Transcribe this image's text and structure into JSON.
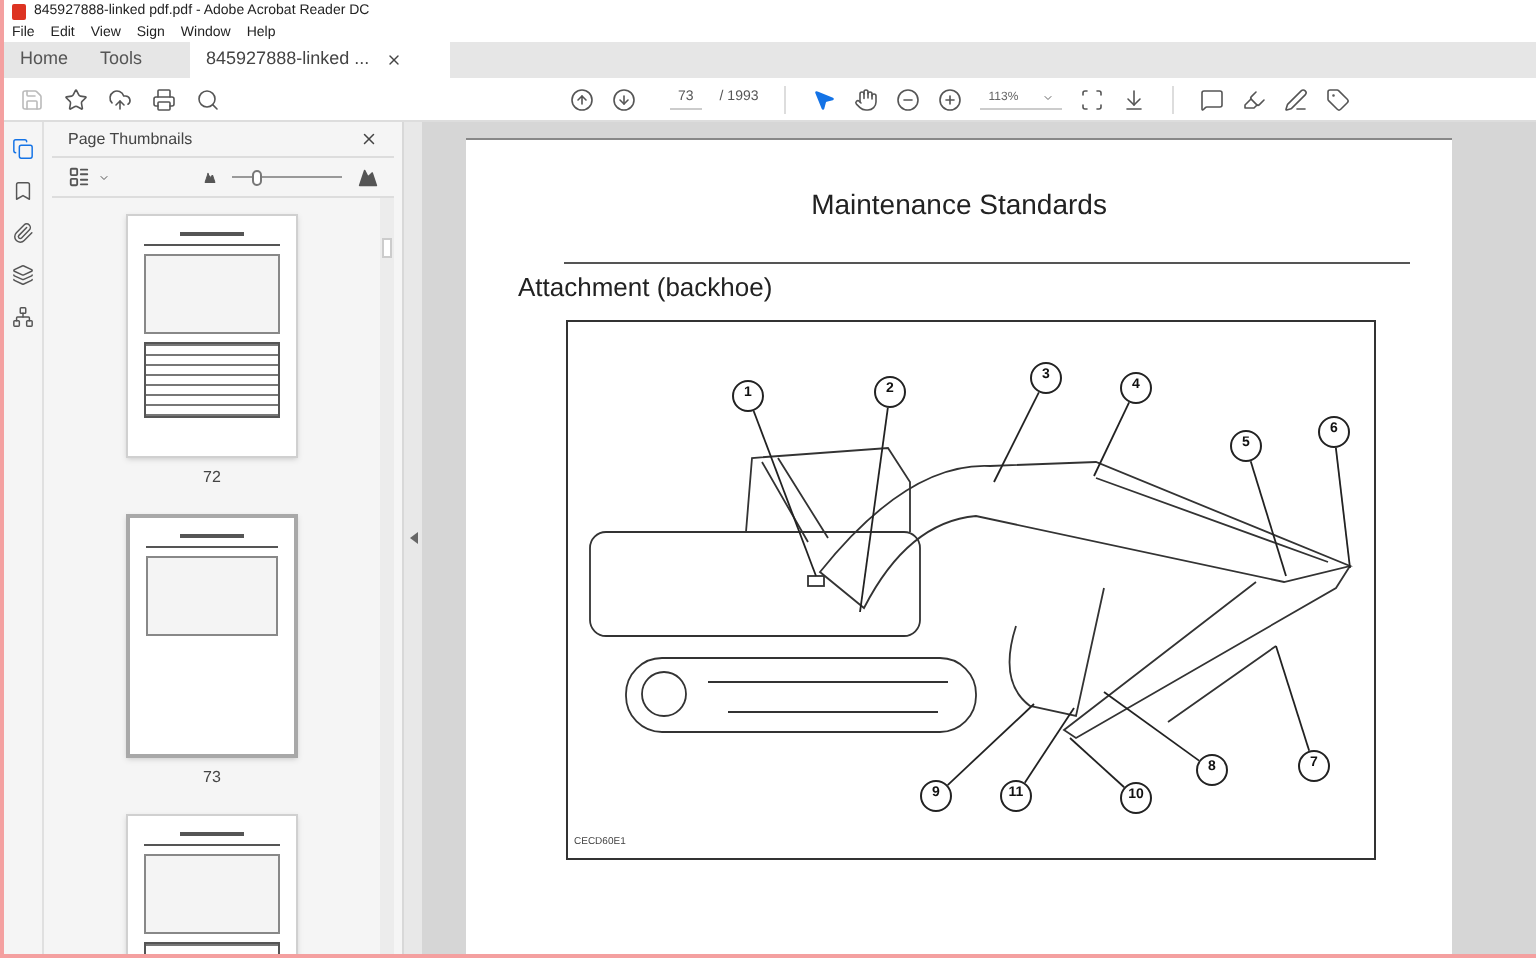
{
  "window": {
    "title": "845927888-linked pdf.pdf - Adobe Acrobat Reader DC"
  },
  "menu": [
    "File",
    "Edit",
    "View",
    "Sign",
    "Window",
    "Help"
  ],
  "tabs": [
    {
      "label": "Home",
      "selected": false,
      "closable": false
    },
    {
      "label": "Tools",
      "selected": false,
      "closable": false
    },
    {
      "label": "845927888-linked ...",
      "selected": true,
      "closable": true
    }
  ],
  "toolbar": {
    "page_input": "73",
    "page_total": "/ 1993",
    "zoom": "113%",
    "tools": [
      {
        "selected": true
      },
      {
        "selected": false
      }
    ]
  },
  "rail": [
    {
      "selected": true
    },
    {
      "selected": false
    },
    {
      "selected": false
    },
    {
      "selected": false
    },
    {
      "selected": false
    }
  ],
  "panel": {
    "title": "Page Thumbnails",
    "thumbnail_size": {
      "level": 0.22
    },
    "thumbnails": [
      {
        "label": "72",
        "selected": false
      },
      {
        "label": "73",
        "selected": true
      },
      {
        "selected": false
      }
    ]
  },
  "document": {
    "heading": "Maintenance Standards",
    "section": "Attachment (backhoe)",
    "figure": {
      "callouts": [
        "1",
        "2",
        "3",
        "4",
        "5",
        "6",
        "7",
        "8",
        "9",
        "11",
        "10"
      ],
      "code": "CECD60E1"
    }
  }
}
